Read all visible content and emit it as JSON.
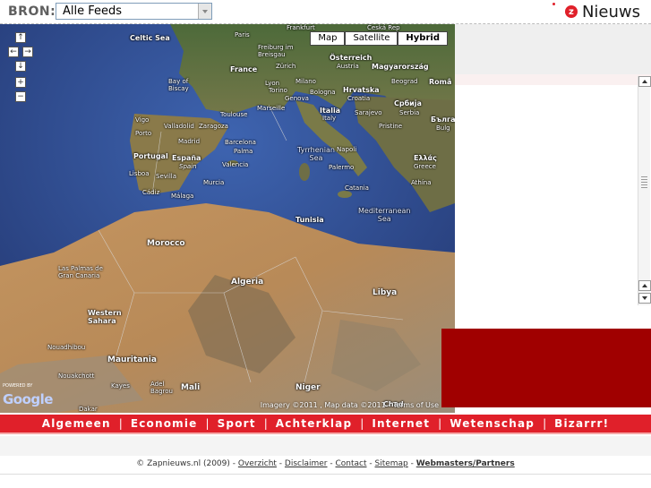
{
  "header": {
    "source_label": "BRON:",
    "feed_select": {
      "value": "Alle Feeds"
    },
    "logo": {
      "mark": "z",
      "text": "Nieuws",
      "color": "#e0202a"
    }
  },
  "map": {
    "type_buttons": [
      "Map",
      "Satellite",
      "Hybrid"
    ],
    "active_type": "Hybrid",
    "nav": {
      "up": "↑",
      "left": "←",
      "right": "→",
      "down": "↓",
      "zoom_in": "+",
      "zoom_out": "−"
    },
    "labels": {
      "celtic_sea": "Celtic Sea",
      "paris": "Paris",
      "france": "France",
      "bay_of_biscay": "Bay of\nBiscay",
      "freiburg": "Freiburg im\nBreisgau",
      "zurich": "Zürich",
      "osterreich": "Österreich",
      "austria": "Austria",
      "magyarorszag": "Magyarország",
      "lyon": "Lyon",
      "torino": "Torino",
      "genova": "Genova",
      "milano": "Milano",
      "bologna": "Bologna",
      "hrvatska": "Hrvatska",
      "croatia": "Croatia",
      "beograd": "Beograd",
      "roman": "Româ",
      "toulouse": "Toulouse",
      "marseille": "Marseille",
      "italia": "Italia",
      "italy": "Italy",
      "sarajevo": "Sarajevo",
      "srbija": "Србија",
      "serbia": "Serbia",
      "balg": "Бълга",
      "bulg": "Bulg",
      "vigo": "Vigo",
      "porto": "Porto",
      "valladolid": "Valladolid",
      "zaragoza": "Zaragoza",
      "madrid": "Madrid",
      "barcelona": "Barcelona",
      "palma": "Palma",
      "tyrrhenian": "Tyrrhenian\nSea",
      "napoli": "Napoli",
      "pristina": "Pristine",
      "portugal": "Portugal",
      "espana": "España",
      "spain": "Spain",
      "valencia": "Valencia",
      "lisboa": "Lisboa",
      "sevilla": "Sevilla",
      "murcia": "Murcia",
      "palermo": "Palermo",
      "ellas": "Ελλάς",
      "greece": "Greece",
      "cadiz": "Cádiz",
      "malaga": "Málaga",
      "catania": "Catania",
      "athina": "Athína",
      "med_sea": "Mediterranean\nSea",
      "tunisia": "Tunisia",
      "morocco": "Morocco",
      "las_palmas": "Las Palmas de\nGran Canaria",
      "algeria": "Algeria",
      "libya": "Libya",
      "western_sahara": "Western\nSahara",
      "nouadhibou": "Nouadhibou",
      "mauritania": "Mauritania",
      "nouakchott": "Nouakchott",
      "mali": "Mali",
      "niger": "Niger",
      "chad": "Chad",
      "kayes": "Kayes",
      "adel": "Adel\nBagrou",
      "dakar": "Dakar",
      "praha": "Česká Rep",
      "frankfurt": "Frankfurt"
    },
    "powered_by": "POWERED BY",
    "google": "Google",
    "attribution": "Imagery ©2011 , Map data ©2011 - Terms of Use"
  },
  "categories": [
    "Algemeen",
    "Economie",
    "Sport",
    "Achterklap",
    "Internet",
    "Wetenschap",
    "Bizarrr!"
  ],
  "footer": {
    "copyright": "© Zapnieuws.nl (2009) -",
    "links": [
      "Overzicht",
      "Disclaimer",
      "Contact",
      "Sitemap"
    ],
    "bold_link": "Webmasters/Partners"
  },
  "colors": {
    "brand_red": "#e0202a",
    "dark_red": "#a00000"
  }
}
